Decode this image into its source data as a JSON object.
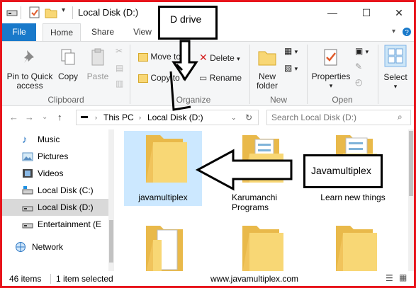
{
  "window": {
    "title": "Local Disk (D:)",
    "controls": {
      "minimize": "—",
      "maximize": "☐",
      "close": "✕"
    }
  },
  "tabs": [
    {
      "label": "File"
    },
    {
      "label": "Home"
    },
    {
      "label": "Share"
    },
    {
      "label": "View"
    }
  ],
  "ribbon": {
    "clipboard": {
      "pin": "Pin to Quick access",
      "copy": "Copy",
      "paste": "Paste",
      "label": "Clipboard"
    },
    "organize": {
      "move_to": "Move to",
      "copy_to": "Copy to",
      "delete": "Delete",
      "rename": "Rename",
      "label": "Organize"
    },
    "new": {
      "new_folder": "New folder",
      "label": "New"
    },
    "open": {
      "properties": "Properties",
      "label": "Open"
    },
    "select": {
      "select": "Select"
    }
  },
  "address": {
    "crumbs": [
      "This PC",
      "Local Disk (D:)"
    ],
    "search_placeholder": "Search Local Disk (D:)"
  },
  "nav": {
    "items": [
      {
        "label": "Music"
      },
      {
        "label": "Pictures"
      },
      {
        "label": "Videos"
      },
      {
        "label": "Local Disk (C:)"
      },
      {
        "label": "Local Disk (D:)"
      },
      {
        "label": "Entertainment (E"
      },
      {
        "label": "Network"
      }
    ]
  },
  "folders": [
    {
      "name": "javamultiplex"
    },
    {
      "name": "Karumanchi Programs"
    },
    {
      "name": "Learn new things"
    }
  ],
  "status": {
    "items_count": "46 items",
    "selected": "1 item selected",
    "watermark": "www.javamultiplex.com"
  },
  "annotations": {
    "d_drive": "D drive",
    "javamultiplex": "Javamultiplex"
  },
  "colors": {
    "border": "#e8141c",
    "file_tab": "#1979ca",
    "folder": "#f8d775",
    "selection": "#cce8ff"
  }
}
